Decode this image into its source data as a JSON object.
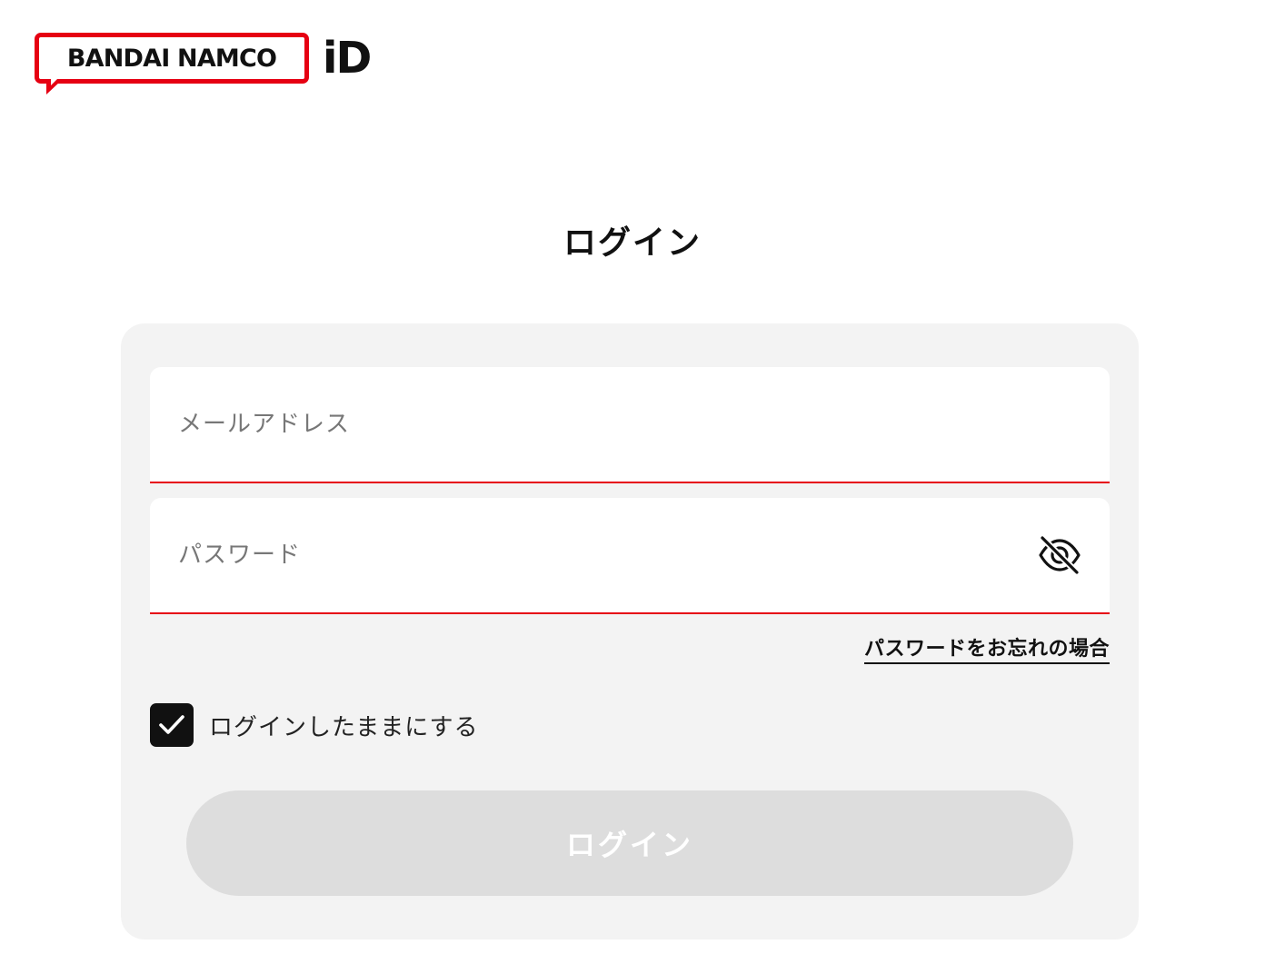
{
  "brand": {
    "logo_text": "BANDAI NAMCO",
    "logo_suffix": "iD",
    "accent_color": "#e60012"
  },
  "page": {
    "title": "ログイン"
  },
  "form": {
    "email": {
      "placeholder": "メールアドレス",
      "value": ""
    },
    "password": {
      "placeholder": "パスワード",
      "value": "",
      "toggle_icon": "eye-slash-icon"
    },
    "forgot_password_label": "パスワードをお忘れの場合",
    "remember_me": {
      "label": "ログインしたままにする",
      "checked": true
    },
    "submit_label": "ログイン",
    "submit_enabled": false
  }
}
